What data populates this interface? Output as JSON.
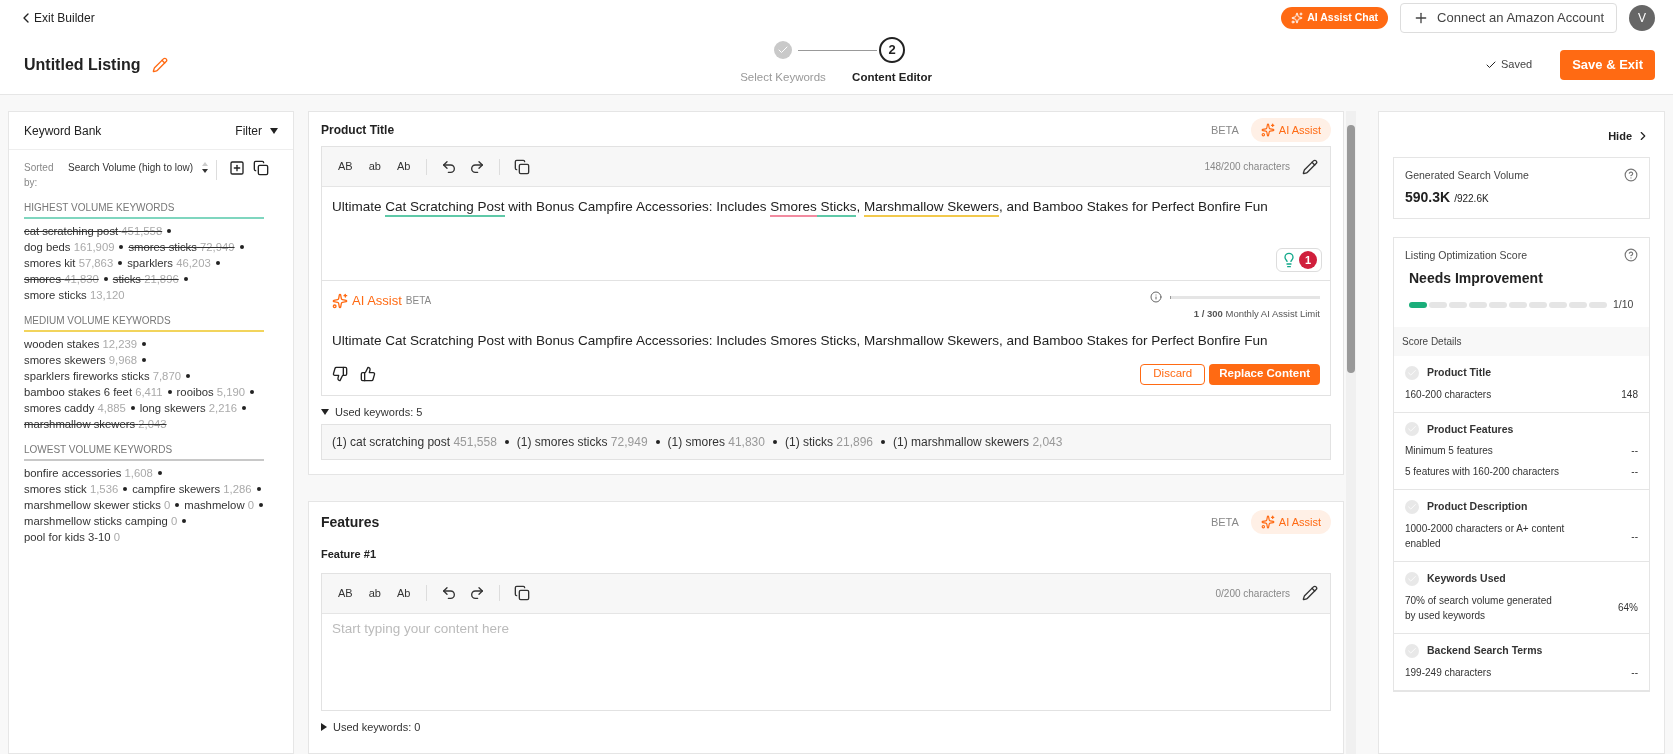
{
  "header": {
    "back": "Exit Builder",
    "ai_chat": "AI Assist Chat",
    "connect": "Connect an Amazon Account",
    "avatar": "V",
    "title": "Untitled Listing",
    "saved": "Saved",
    "save_exit": "Save & Exit"
  },
  "steps": [
    {
      "label": "Select Keywords",
      "done": true,
      "selected": false
    },
    {
      "label": "Content Editor",
      "number": "2",
      "done": false,
      "selected": true
    }
  ],
  "keyword_bank": {
    "title": "Keyword Bank",
    "filter": "Filter",
    "sorted_label": "Sorted by:",
    "sorted_value": "Search Volume (high to low)",
    "groups": [
      {
        "title": "HIGHEST VOLUME KEYWORDS",
        "color": "#7fd6bf",
        "keywords": [
          {
            "name": "cat scratching post",
            "volume": "451,558",
            "used": true
          },
          {
            "name": "dog beds",
            "volume": "161,909",
            "used": false
          },
          {
            "name": "smores sticks",
            "volume": "72,949",
            "used": true
          },
          {
            "name": "smores kit",
            "volume": "57,863",
            "used": false
          },
          {
            "name": "sparklers",
            "volume": "46,203",
            "used": false
          },
          {
            "name": "smores",
            "volume": "41,830",
            "used": true
          },
          {
            "name": "sticks",
            "volume": "21,896",
            "used": true
          },
          {
            "name": "smore sticks",
            "volume": "13,120",
            "used": false
          }
        ]
      },
      {
        "title": "MEDIUM VOLUME KEYWORDS",
        "color": "#f2d45c",
        "keywords": [
          {
            "name": "wooden stakes",
            "volume": "12,239",
            "used": false
          },
          {
            "name": "smores skewers",
            "volume": "9,968",
            "used": false
          },
          {
            "name": "sparklers fireworks sticks",
            "volume": "7,870",
            "used": false
          },
          {
            "name": "bamboo stakes 6 feet",
            "volume": "6,411",
            "used": false
          },
          {
            "name": "rooibos",
            "volume": "5,190",
            "used": false
          },
          {
            "name": "smores caddy",
            "volume": "4,885",
            "used": false
          },
          {
            "name": "long skewers",
            "volume": "2,216",
            "used": false
          },
          {
            "name": "marshmallow skewers",
            "volume": "2,043",
            "used": true
          }
        ]
      },
      {
        "title": "LOWEST VOLUME KEYWORDS",
        "color": "#c8c8c8",
        "keywords": [
          {
            "name": "bonfire accessories",
            "volume": "1,608",
            "used": false
          },
          {
            "name": "smores stick",
            "volume": "1,536",
            "used": false
          },
          {
            "name": "campfire skewers",
            "volume": "1,286",
            "used": false
          },
          {
            "name": "marshmellow skewer sticks",
            "volume": "0",
            "used": false
          },
          {
            "name": "mashmelow",
            "volume": "0",
            "used": false
          },
          {
            "name": "marshmellow sticks camping",
            "volume": "0",
            "used": false
          },
          {
            "name": "pool for kids 3-10",
            "volume": "0",
            "used": false
          }
        ]
      }
    ]
  },
  "editor": {
    "sections": [
      {
        "kind": "title",
        "title": "Product Title",
        "beta": "BETA",
        "ai_assist": "AI Assist",
        "tools": [
          "AB",
          "ab",
          "Ab"
        ],
        "char_count": "148/200 characters",
        "segments": [
          {
            "text": "Ultimate "
          },
          {
            "text": "Cat Scratching Post",
            "color": "#5fc9a8"
          },
          {
            "text": " with Bonus Campfire Accessories: Includes "
          },
          {
            "text": "Smores",
            "color": "#f28ba0"
          },
          {
            "text": " Sticks",
            "color": "#5fc9a8"
          },
          {
            "text": ", "
          },
          {
            "text": "Marshmallow Skewers",
            "color": "#f2c94c"
          },
          {
            "text": ", and Bamboo Stakes for Perfect Bonfire Fun"
          }
        ],
        "issue_count": "1",
        "ai": {
          "label": "AI Assist",
          "beta": "BETA",
          "usage": "1 / 300",
          "usage_label": "Monthly AI Assist Limit",
          "level": 0.004,
          "suggestion": "Ultimate Cat Scratching Post with Bonus Campfire Accessories: Includes Smores Sticks, Marshmallow Skewers, and Bamboo Stakes for Perfect Bonfire Fun",
          "discard": "Discard",
          "replace": "Replace Content"
        },
        "used": {
          "label": "Used keywords: 5",
          "expanded": true,
          "items": [
            {
              "count": "(1)",
              "name": "cat scratching post",
              "volume": "451,558"
            },
            {
              "count": "(1)",
              "name": "smores sticks",
              "volume": "72,949"
            },
            {
              "count": "(1)",
              "name": "smores",
              "volume": "41,830"
            },
            {
              "count": "(1)",
              "name": "sticks",
              "volume": "21,896"
            },
            {
              "count": "(1)",
              "name": "marshmallow skewers",
              "volume": "2,043"
            }
          ]
        }
      },
      {
        "kind": "features",
        "title": "Features",
        "beta": "BETA",
        "ai_assist": "AI Assist",
        "subtitle": "Feature #1",
        "tools": [
          "AB",
          "ab",
          "Ab"
        ],
        "char_count": "0/200 characters",
        "placeholder": "Start typing your content here",
        "used": {
          "label": "Used keywords: 0",
          "expanded": false
        }
      }
    ]
  },
  "score_panel": {
    "hide": "Hide",
    "volume_label": "Generated Search Volume",
    "volume": "590.3K",
    "volume_total": "/922.6K",
    "score_label": "Listing Optimization Score",
    "score_status": "Needs Improvement",
    "level": 0.1,
    "score": "1/10",
    "details_label": "Score Details",
    "details": [
      {
        "title": "Product Title",
        "rows": [
          {
            "label": "160-200 characters",
            "value": "148"
          }
        ]
      },
      {
        "title": "Product Features",
        "rows": [
          {
            "label": "Minimum 5 features",
            "value": "--"
          },
          {
            "label": "5 features with 160-200 characters",
            "value": "--"
          }
        ]
      },
      {
        "title": "Product Description",
        "rows": [
          {
            "label": "1000-2000 characters or A+ content enabled",
            "value": "--"
          }
        ]
      },
      {
        "title": "Keywords Used",
        "rows": [
          {
            "label": "70% of search volume generated by used keywords",
            "value": "64%"
          }
        ]
      },
      {
        "title": "Backend Search Terms",
        "rows": [
          {
            "label": "199-249 characters",
            "value": "--"
          }
        ]
      }
    ]
  }
}
